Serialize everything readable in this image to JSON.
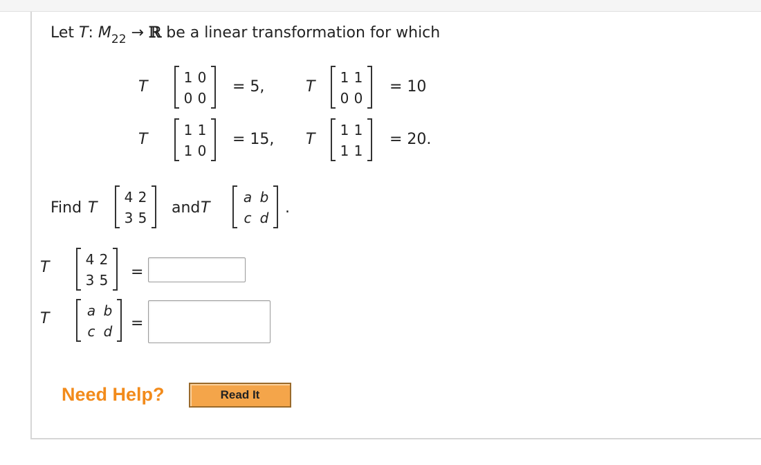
{
  "problem": {
    "intro_prefix": "Let ",
    "intro_T": "T",
    "intro_colon": ": ",
    "intro_M": "M",
    "intro_sub": "22",
    "intro_arrow": " → ",
    "intro_R": "ℝ",
    "intro_rest": " be a linear transformation for which",
    "T_symbol": "T",
    "given": [
      {
        "matrix": [
          "1",
          "0",
          "0",
          "0"
        ],
        "result": "= 5,"
      },
      {
        "matrix": [
          "1",
          "1",
          "0",
          "0"
        ],
        "result": "= 10"
      },
      {
        "matrix": [
          "1",
          "1",
          "1",
          "0"
        ],
        "result": "= 15,"
      },
      {
        "matrix": [
          "1",
          "1",
          "1",
          "1"
        ],
        "result": "= 20."
      }
    ],
    "find_label": "Find ",
    "find_matrix1": [
      "4",
      "2",
      "3",
      "5"
    ],
    "and_label": "and ",
    "find_matrix2": [
      "a",
      "b",
      "c",
      "d"
    ],
    "period": "."
  },
  "answers": [
    {
      "matrix": [
        "4",
        "2",
        "3",
        "5"
      ],
      "equals": "=",
      "value": ""
    },
    {
      "matrix": [
        "a",
        "b",
        "c",
        "d"
      ],
      "equals": "=",
      "value": ""
    }
  ],
  "help": {
    "need_help": "Need Help?",
    "read_it": "Read It"
  },
  "colors": {
    "accent": "#f28b1b",
    "button_bg": "#f4a54a"
  }
}
